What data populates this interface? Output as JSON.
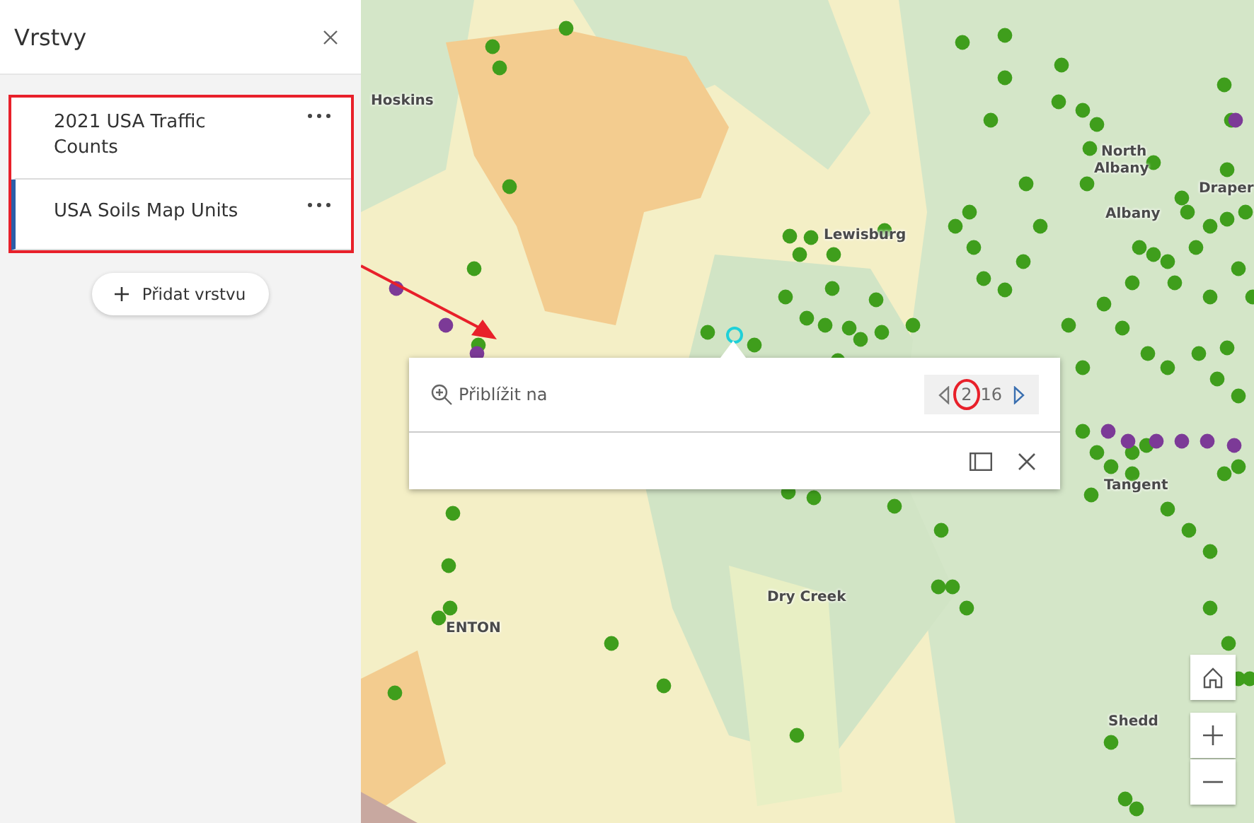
{
  "sidebar": {
    "title": "Vrstvy",
    "layers": [
      {
        "name": "2021 USA Traffic Counts",
        "selected": false
      },
      {
        "name": "USA Soils Map Units",
        "selected": true
      }
    ],
    "add_button": "Přidat vrstvu"
  },
  "map": {
    "places": [
      {
        "name": "Hoskins"
      },
      {
        "name": "North"
      },
      {
        "name": "Albany"
      },
      {
        "name": "Draper"
      },
      {
        "name": "Albany"
      },
      {
        "name": "Lewisburg"
      },
      {
        "name": "Tangent"
      },
      {
        "name": "Dry Creek"
      },
      {
        "name": "ENTON"
      },
      {
        "name": "Shedd"
      }
    ]
  },
  "popup": {
    "zoom_label": "Přiblížit na",
    "current": "2",
    "total": "16"
  }
}
